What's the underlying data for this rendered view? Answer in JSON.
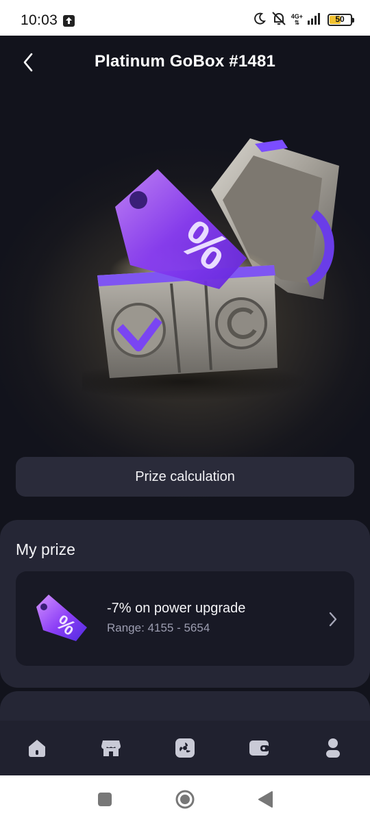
{
  "status_bar": {
    "time": "10:03",
    "network": "4G+",
    "battery": "50",
    "battery_level": 0.5
  },
  "header": {
    "title": "Platinum GoBox #1481",
    "back_icon": "chevron-left-icon"
  },
  "hero": {
    "icon": "open-chest-with-discount-tag-illustration"
  },
  "prize_calc_button": {
    "label": "Prize calculation"
  },
  "my_prize": {
    "title": "My prize",
    "item": {
      "name": "-7% on power upgrade",
      "range": "Range: 4155 - 5654",
      "icon": "discount-tag-icon"
    }
  },
  "bottom_nav": {
    "items": [
      {
        "icon": "home-icon"
      },
      {
        "icon": "store-icon"
      },
      {
        "icon": "mining-fan-icon"
      },
      {
        "icon": "wallet-icon"
      },
      {
        "icon": "profile-icon"
      }
    ]
  },
  "colors": {
    "accent": "#8a4dff",
    "background": "#12131c",
    "card": "#252635"
  }
}
